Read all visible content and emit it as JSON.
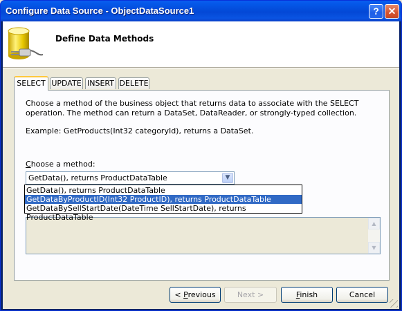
{
  "window": {
    "title": "Configure Data Source - ObjectDataSource1",
    "help_label": "?",
    "close_label": "✕"
  },
  "header": {
    "title": "Define Data Methods",
    "icon": "database-plug-icon"
  },
  "tabs": [
    {
      "label": "SELECT",
      "active": true
    },
    {
      "label": "UPDATE",
      "active": false
    },
    {
      "label": "INSERT",
      "active": false
    },
    {
      "label": "DELETE",
      "active": false
    }
  ],
  "select_panel": {
    "description": "Choose a method of the business object that returns data to associate with the SELECT operation. The method can return a DataSet, DataReader, or strongly-typed collection.",
    "example": "Example: GetProducts(Int32 categoryId), returns a DataSet.",
    "choose_label_first": "C",
    "choose_label_rest": "hoose a method:",
    "combo_value": "GetData(), returns ProductDataTable",
    "options": [
      {
        "label": "GetData(), returns ProductDataTable",
        "selected": false
      },
      {
        "label": "GetDataByProductID(Int32 ProductID), returns ProductDataTable",
        "selected": true
      },
      {
        "label": "GetDataBySellStartDate(DateTime SellStartDate), returns ProductDataTable",
        "selected": false
      }
    ]
  },
  "buttons": {
    "previous_prefix": "< ",
    "previous_accel": "P",
    "previous_rest": "revious",
    "next": "Next >",
    "finish_accel": "F",
    "finish_rest": "inish",
    "cancel": "Cancel"
  },
  "colors": {
    "title_bar": "#0456e6",
    "highlight": "#316ac5",
    "active_tab_accent": "#ffc83c"
  }
}
